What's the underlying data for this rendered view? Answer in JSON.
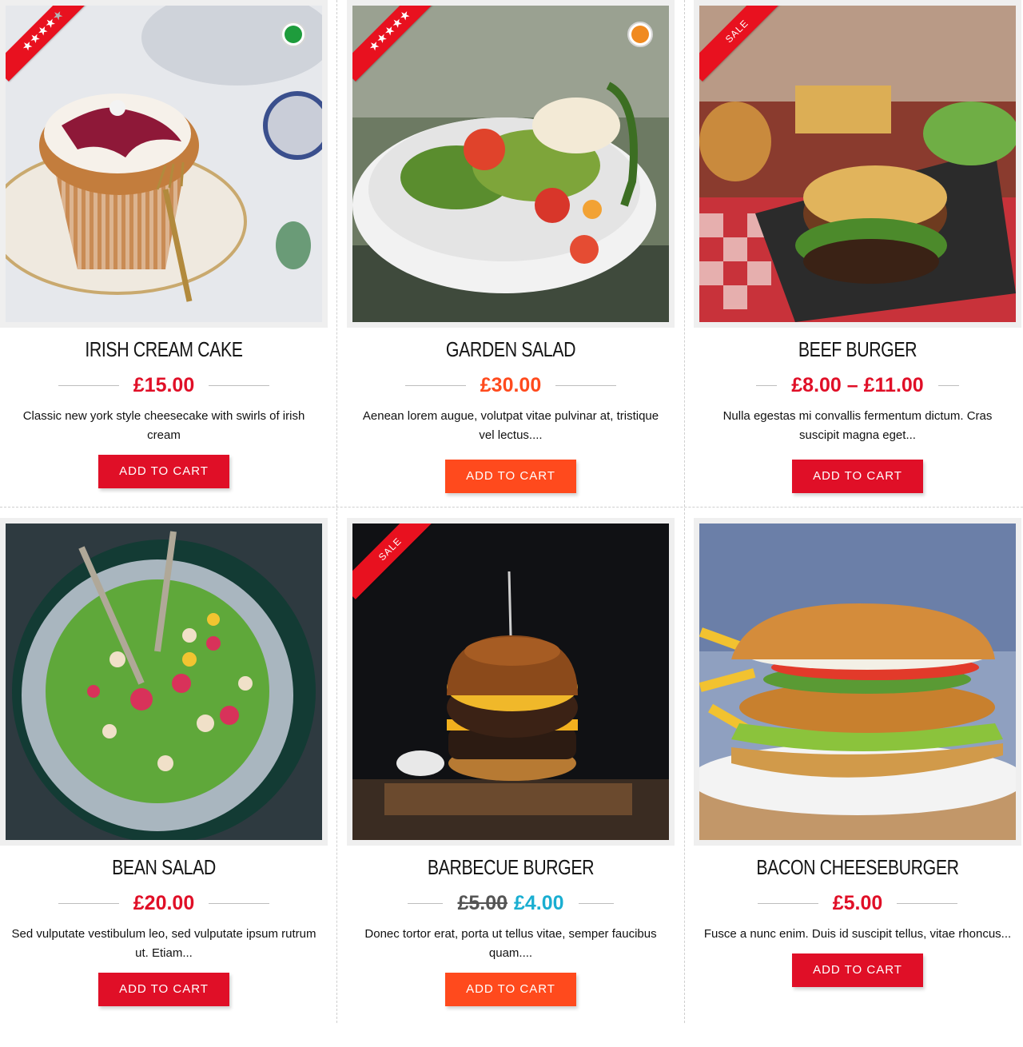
{
  "products": [
    {
      "name": "IRISH CREAM CAKE",
      "price": "£15.00",
      "description": "Classic new york style cheesecake with swirls of irish cream",
      "button": "ADD TO CART",
      "rating_stars": "★★★★",
      "rating_empty": "★",
      "badge_icon": "vegetarian-leaf-icon",
      "price_color": "#e00f27"
    },
    {
      "name": "GARDEN SALAD",
      "price": "£30.00",
      "description": "Aenean lorem augue, volutpat vitae pulvinar at, tristique vel lectus....",
      "button": "ADD TO CART",
      "rating_stars": "★★★★★",
      "badge_icon": "chili-spicy-icon",
      "price_color": "#ff4a1d"
    },
    {
      "name": "BEEF BURGER",
      "price": "£8.00 – £11.00",
      "description": "Nulla egestas mi convallis fermentum dictum. Cras suscipit magna eget...",
      "button": "ADD TO CART",
      "ribbon": "SALE",
      "price_color": "#e00f27"
    },
    {
      "name": "BEAN SALAD",
      "price": "£20.00",
      "description": "Sed vulputate vestibulum leo, sed vulputate ipsum rutrum ut. Etiam...",
      "button": "ADD TO CART",
      "price_color": "#e00f27"
    },
    {
      "name": "BARBECUE BURGER",
      "price_old": "£5.00",
      "price_new": "£4.00",
      "description": "Donec tortor erat, porta ut tellus vitae, semper faucibus quam....",
      "button": "ADD TO CART",
      "ribbon": "SALE",
      "price_color": "#1aaed1"
    },
    {
      "name": "BACON CHEESEBURGER",
      "price": "£5.00",
      "description": "Fusce a nunc enim. Duis id suscipit tellus, vitae rhoncus...",
      "button": "ADD TO CART",
      "price_color": "#e00f27"
    }
  ],
  "colors": {
    "brand_red": "#e00f27",
    "brand_orange": "#ff4a1d",
    "sale_price": "#1aaed1"
  }
}
